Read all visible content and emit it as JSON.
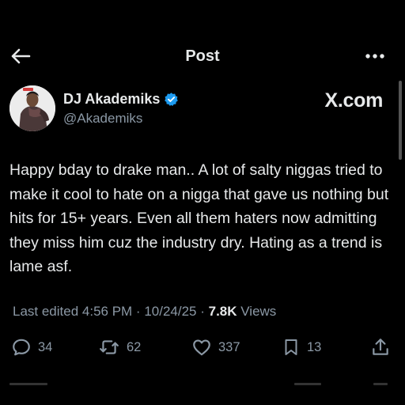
{
  "header": {
    "title": "Post",
    "back_icon": "arrow-left-icon",
    "more_icon": "more-horizontal-icon"
  },
  "author": {
    "display_name": "DJ Akademiks",
    "handle": "@Akademiks",
    "verified_color": "#1d9bf0"
  },
  "watermark": "X.com",
  "tweet": {
    "text": "Happy bday to drake man.. A lot of salty niggas tried to make it cool to hate on a nigga that gave us nothing but hits for 15+ years. Even all them haters now admitting they miss him cuz the industry dry. Hating as a trend is lame asf."
  },
  "meta": {
    "edited_time": "Last edited 4:56 PM · 10/24/25 · ",
    "views_count": "7.8K",
    "views_label": " Views"
  },
  "actions": {
    "replies": "34",
    "reposts": "62",
    "likes": "337",
    "bookmarks": "13"
  },
  "colors": {
    "background": "#000000",
    "text": "#e7e9ea",
    "muted": "#8b98a5",
    "accent": "#1d9bf0"
  }
}
